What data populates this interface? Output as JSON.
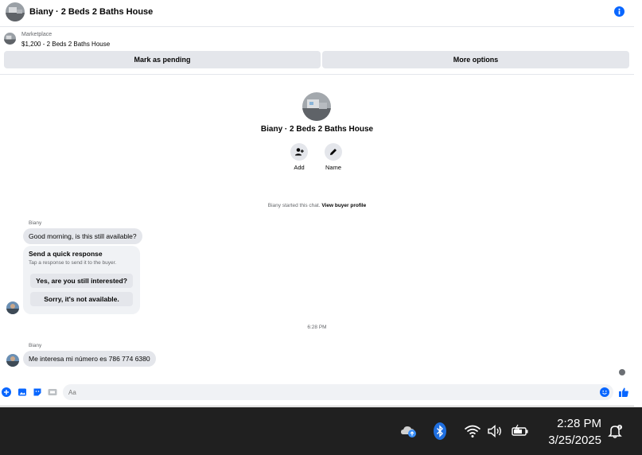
{
  "header": {
    "title": "Biany · 2 Beds 2 Baths House",
    "info_icon": "info-icon"
  },
  "listing": {
    "label": "Marketplace",
    "price_title": "$1,200 - 2 Beds 2 Baths House"
  },
  "actions": {
    "pending_label": "Mark as pending",
    "more_label": "More options"
  },
  "profile": {
    "name": "Biany · 2 Beds 2 Baths House",
    "add_label": "Add",
    "name_label": "Name"
  },
  "chat": {
    "started_prefix": "Biany started this chat.",
    "started_link": "View buyer profile",
    "sender": "Biany",
    "message1": "Good morning, is this still available?",
    "quick": {
      "title": "Send a quick response",
      "subtitle": "Tap a response to send it to the buyer.",
      "option1": "Yes, are you still interested?",
      "option2": "Sorry, it's not available."
    },
    "timestamp": "6:28 PM",
    "message2": "Me interesa mi número es 786 774 6380"
  },
  "composer": {
    "placeholder": "Aa"
  },
  "taskbar": {
    "time": "2:28 PM",
    "date": "3/25/2025"
  },
  "colors": {
    "accent": "#0866ff",
    "bubble": "#e4e6eb",
    "taskbar": "#202020"
  }
}
